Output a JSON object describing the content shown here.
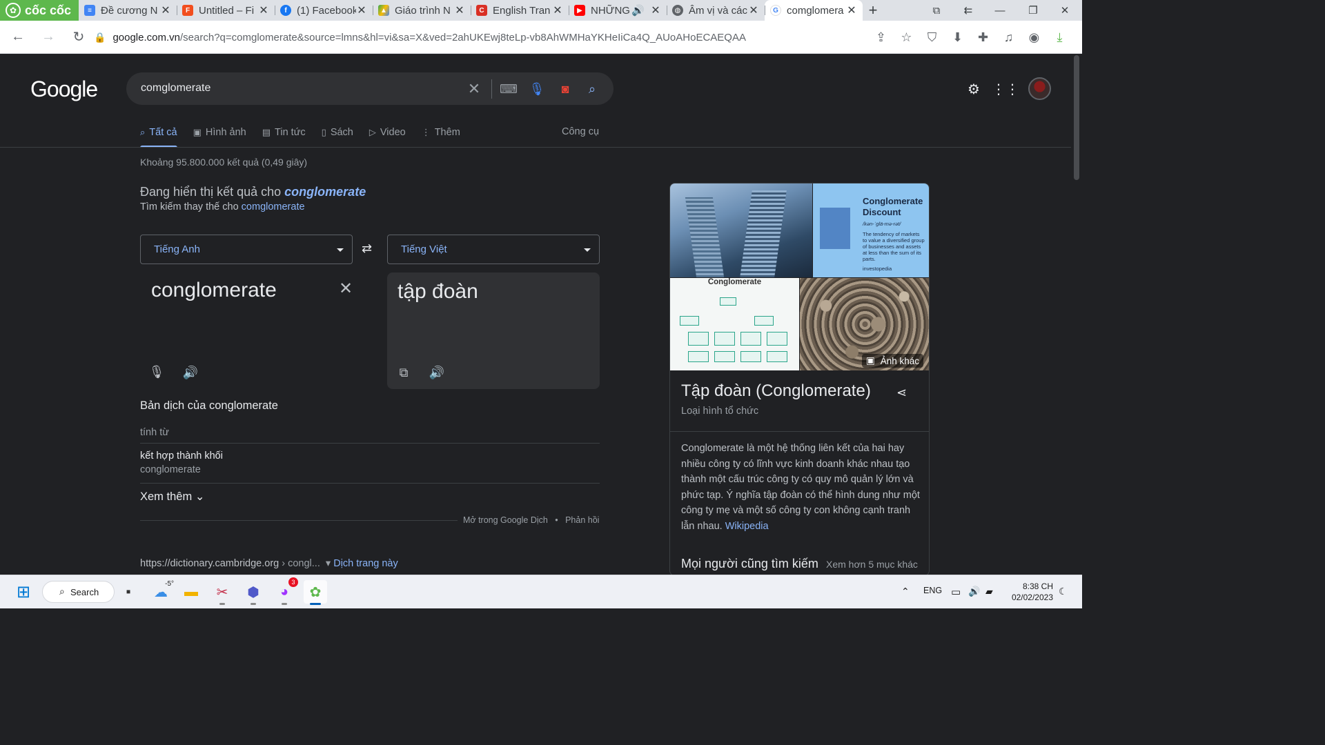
{
  "browser": {
    "brand": "cốc cốc",
    "tabs": [
      {
        "title": "Đề cương N",
        "favicon_color": "#4285f4"
      },
      {
        "title": "Untitled – Fi",
        "favicon_color": "#f24e1e"
      },
      {
        "title": "(1) Facebook",
        "favicon_color": "#1877f2"
      },
      {
        "title": "Giáo trình N",
        "favicon_color": "#34a853"
      },
      {
        "title": "English Tran",
        "favicon_color": "#d93025"
      },
      {
        "title": "NHỮNG",
        "favicon_color": "#ff0000"
      },
      {
        "title": "Âm vị và các",
        "favicon_color": "#5f6368"
      },
      {
        "title": "comglomera",
        "favicon_color": "#4285f4"
      }
    ],
    "url_host": "google.com.vn",
    "url_rest": "/search?q=comglomerate&source=lmns&hl=vi&sa=X&ved=2ahUKEwj8teLp-vb8AhWMHaYKHeIiCa4Q_AUoAHoECAEQAA"
  },
  "google": {
    "logo": "Google",
    "query": "comglomerate",
    "tabs": [
      {
        "label": "Tất cả",
        "icon": "search-icon"
      },
      {
        "label": "Hình ảnh",
        "icon": "image-icon"
      },
      {
        "label": "Tin tức",
        "icon": "news-icon"
      },
      {
        "label": "Sách",
        "icon": "book-icon"
      },
      {
        "label": "Video",
        "icon": "video-icon"
      },
      {
        "label": "Thêm",
        "icon": "more-vert-icon"
      }
    ],
    "tools": "Công cụ",
    "stats": "Khoảng 95.800.000 kết quả (0,49 giây)",
    "spell_prefix": "Đang hiển thị kết quả cho",
    "spell_corrected": "conglomerate",
    "spell_alt_prefix": "Tìm kiếm thay thế cho",
    "spell_alt": "comglomerate"
  },
  "translate": {
    "source_lang": "Tiếng Anh",
    "target_lang": "Tiếng Việt",
    "source_text": "conglomerate",
    "target_text": "tập đoàn",
    "dict_title": "Bản dịch của conglomerate",
    "pos": "tính từ",
    "translation": "kết hợp thành khối",
    "translation_back": "conglomerate",
    "see_more": "Xem thêm",
    "open_in": "Mở trong Google Dịch",
    "dot": "•",
    "feedback": "Phản hồi"
  },
  "result": {
    "cite_host": "https://dictionary.cambridge.org",
    "cite_path": "› congl...",
    "translate_page": "Dịch trang này"
  },
  "knowledge_panel": {
    "img2_title": "Conglomerate Discount",
    "img2_pron": "/kən-ˈglä-mə-rət/",
    "img2_body": "The tendency of markets to value a diversified group of businesses and assets at less than the sum of its parts.",
    "img2_source": "investopedia",
    "img3_title": "Conglomerate",
    "more_images": "Ảnh khác",
    "title": "Tập đoàn (Conglomerate)",
    "subtitle": "Loại hình tổ chức",
    "description": "Conglomerate là một hệ thống liên kết của hai hay nhiều công ty có lĩnh vực kinh doanh khác nhau tạo thành một cấu trúc công ty có quy mô quản lý lớn và phức tạp. Ý nghĩa tập đoàn có thể hình dung như một công ty mẹ và một số công ty con không cạnh tranh lẫn nhau.",
    "wiki": "Wikipedia",
    "also_search": "Mọi người cũng tìm kiếm",
    "also_more": "Xem hơn 5 mục khác"
  },
  "taskbar": {
    "search": "Search",
    "weather": "-5°",
    "messenger_badge": "3",
    "lang": "ENG",
    "time": "8:38 CH",
    "date": "02/02/2023"
  }
}
